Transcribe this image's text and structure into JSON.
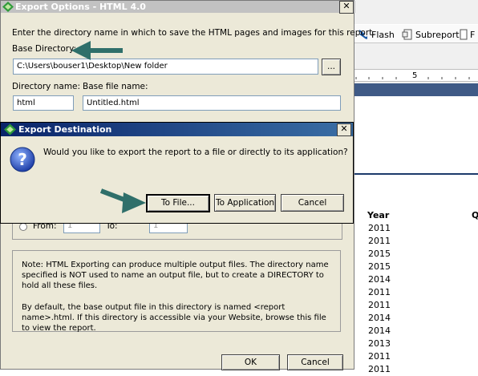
{
  "background": {
    "toolbar": {
      "flash_label": "Flash",
      "subreport_label": "Subreport",
      "partial_label": "F"
    },
    "ruler_mark": "5",
    "year_header": "Year",
    "q_header": "Q",
    "years": [
      "2011",
      "2011",
      "2015",
      "2015",
      "2014",
      "2011",
      "2011",
      "2014",
      "2014",
      "2013",
      "2011",
      "2011"
    ]
  },
  "export_options": {
    "title": "Export Options - HTML 4.0",
    "intro": "Enter the directory name in which to save the HTML pages and images for this report.",
    "base_dir_label": "Base Directory:",
    "base_dir_value": "C:\\Users\\bouser1\\Desktop\\New folder",
    "browse_label": "...",
    "dir_name_label": "Directory name:",
    "dir_name_value": "html",
    "base_file_label": "Base file name:",
    "base_file_value": "Untitled.html",
    "from_label": "From:",
    "from_value": "1",
    "to_label": "To:",
    "to_value": "1",
    "note_p1": "Note: HTML Exporting can produce multiple output files. The directory name specified is NOT used to name an output file, but to create a DIRECTORY to hold all these files.",
    "note_p2": "By default, the base output file in this directory is named <report name>.html. If this directory is accessible via your Website, browse this file to view the report.",
    "ok_label": "OK",
    "cancel_label": "Cancel"
  },
  "export_destination": {
    "title": "Export Destination",
    "question": "Would you like to export the report to a file or directly to its application?",
    "to_file_label": "To File...",
    "to_app_label": "To Application",
    "cancel_label": "Cancel"
  },
  "colors": {
    "dialog_bg": "#ece9d8",
    "title_active": "#0a246a",
    "arrow": "#2f6f6a"
  }
}
